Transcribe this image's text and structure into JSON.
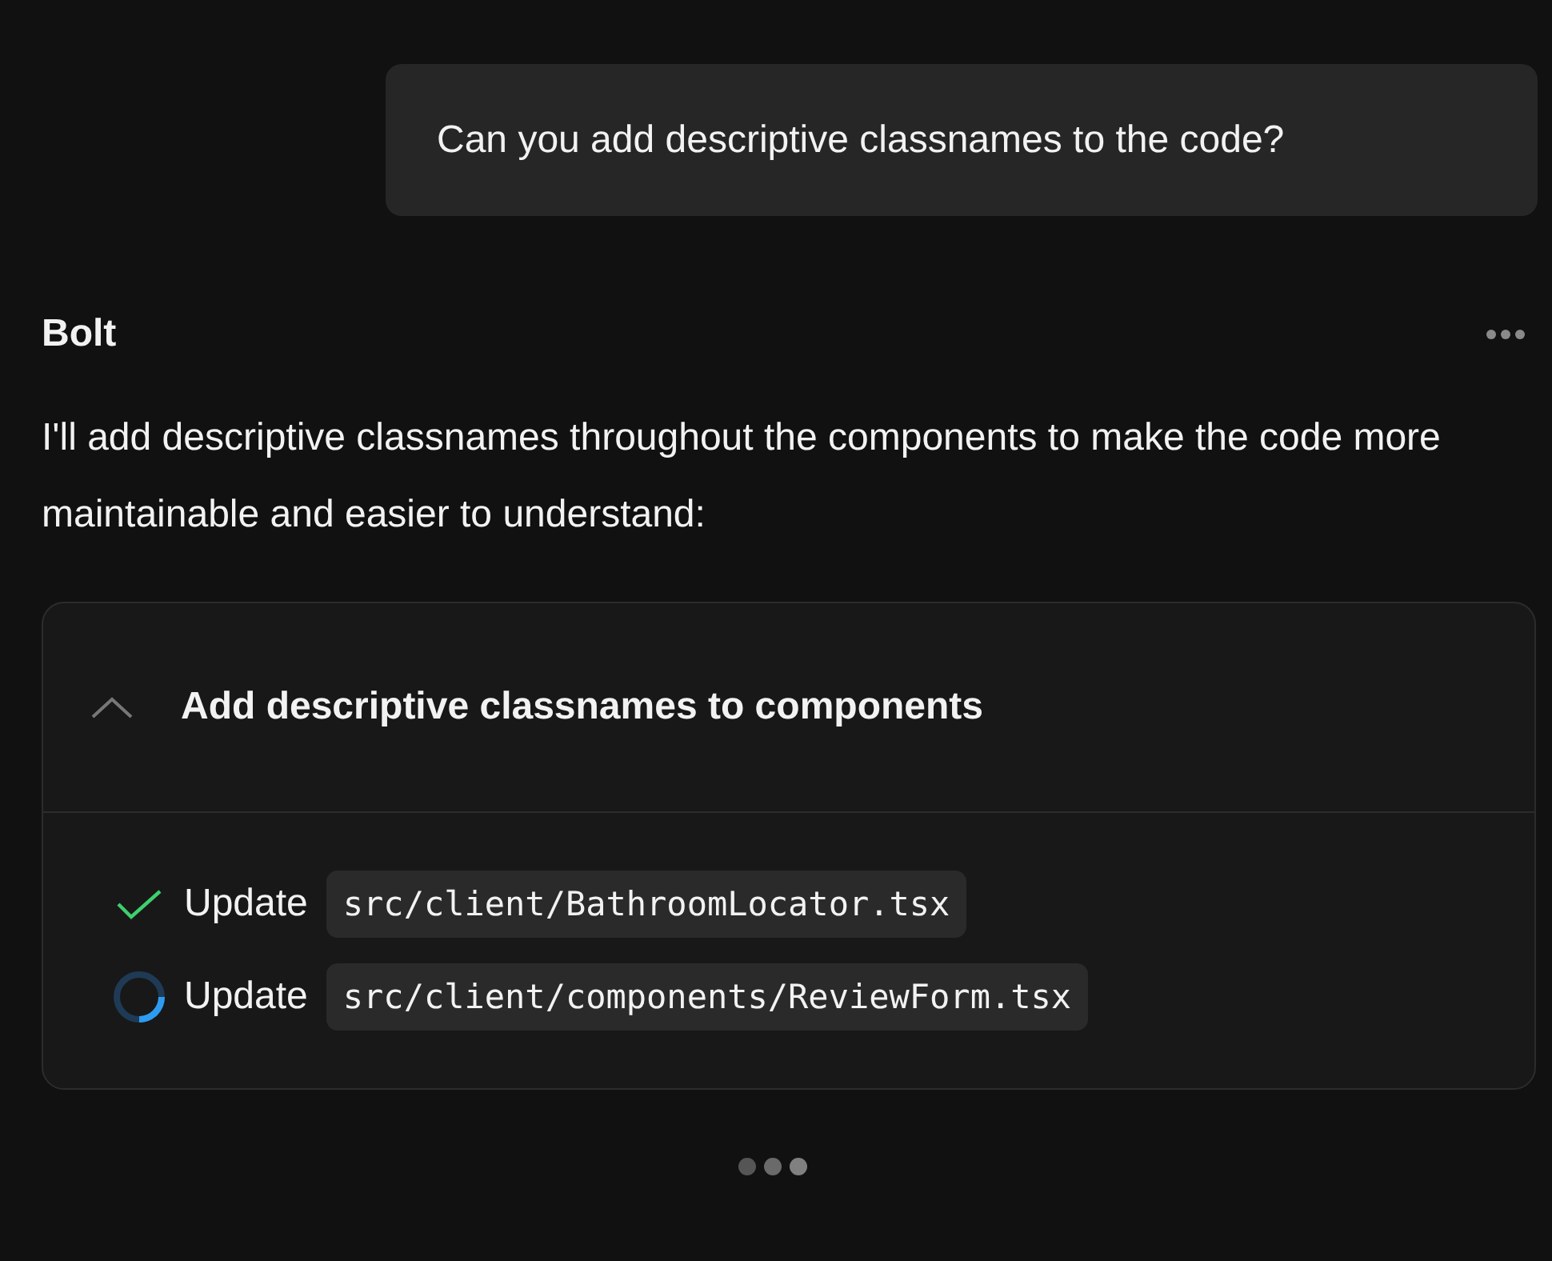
{
  "user_message": {
    "text": "Can you add descriptive classnames to the code?"
  },
  "assistant": {
    "name": "Bolt",
    "text": "I'll add descriptive classnames throughout the components to make the code more maintainable and easier to understand:"
  },
  "action_card": {
    "title": "Add descriptive classnames to components",
    "expanded": true,
    "tasks": [
      {
        "kind": "done",
        "label": "Update",
        "path": "src/client/BathroomLocator.tsx"
      },
      {
        "kind": "running",
        "label": "Update",
        "path": "src/client/components/ReviewForm.tsx"
      }
    ]
  }
}
